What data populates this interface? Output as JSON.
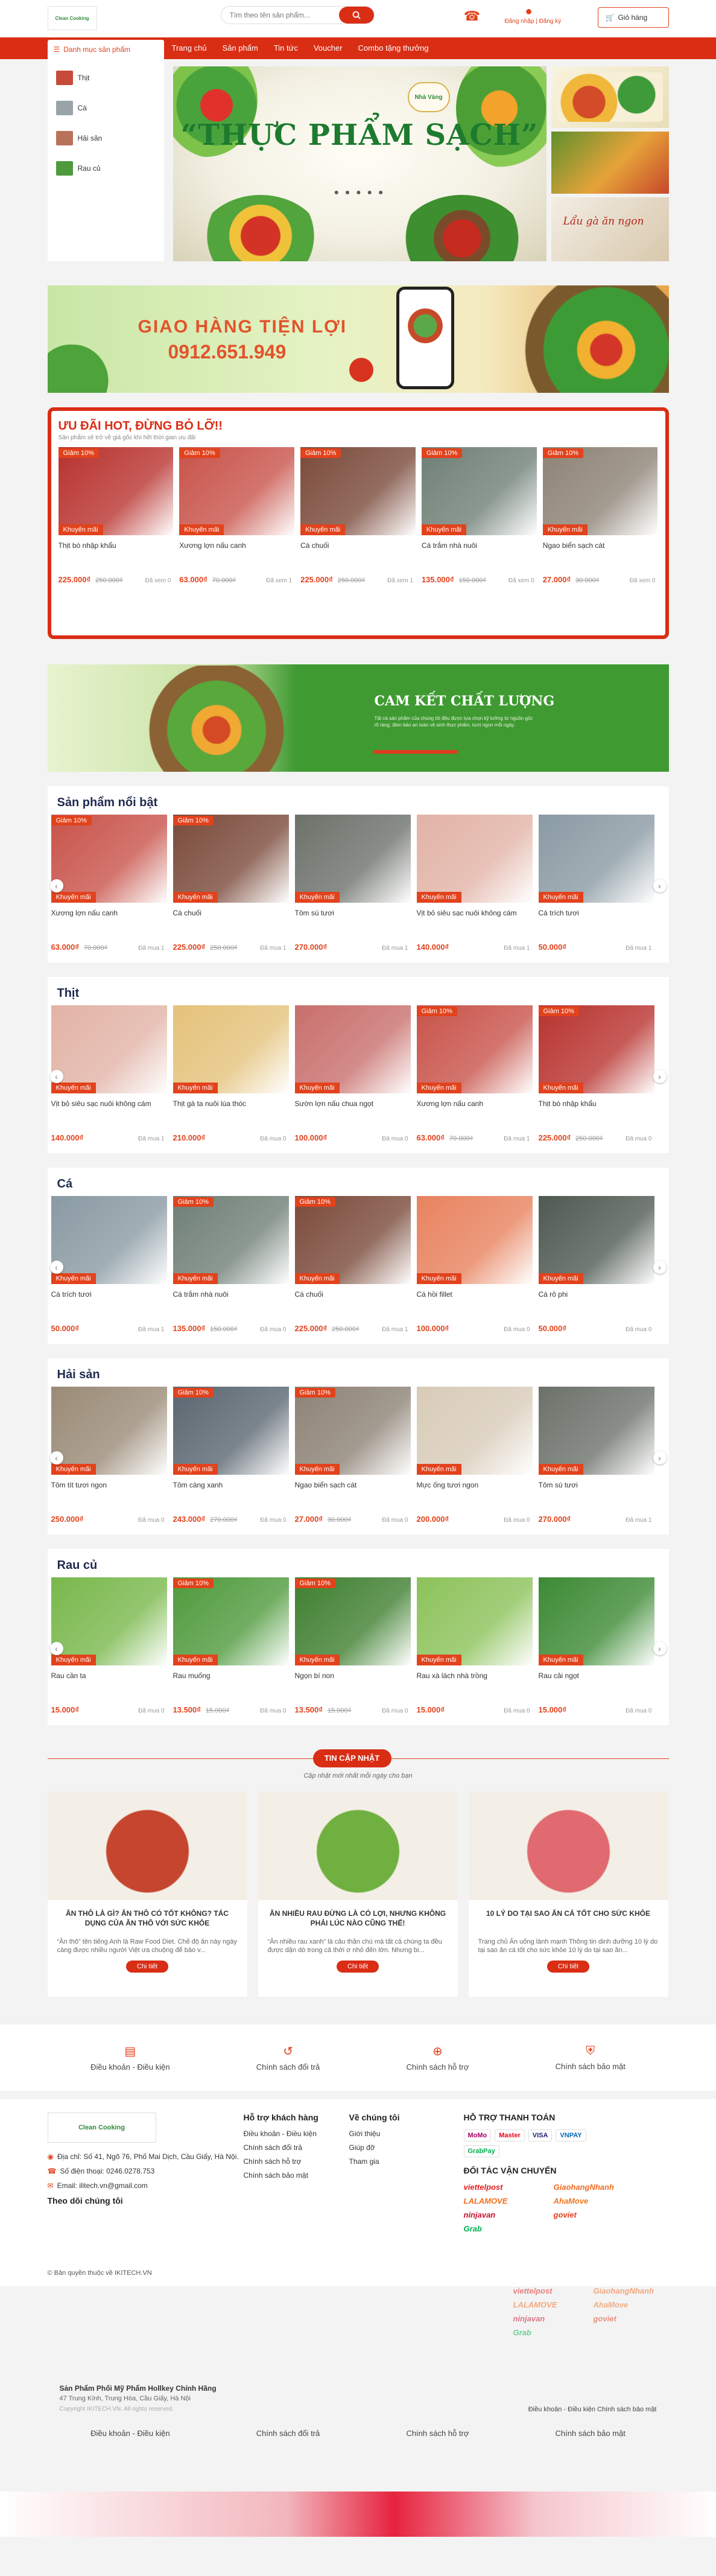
{
  "header": {
    "logo_text": "Clean Cooking",
    "search_placeholder": "Tìm theo tên sản phẩm...",
    "login_label": "Đăng nhập | Đăng ký",
    "cart_label": "Giỏ hàng",
    "cart_count": "0"
  },
  "nav": {
    "category_button": "Danh mục sản phẩm",
    "items": [
      "Trang chủ",
      "Sản phẩm",
      "Tin tức",
      "Voucher",
      "Combo tặng thưởng"
    ]
  },
  "sidebar": {
    "items": [
      "Thịt",
      "Cá",
      "Hải sản",
      "Rau củ"
    ]
  },
  "hero": {
    "title": "“THỰC PHẨM SẠCH”",
    "badge": "Nhà Vàng",
    "side_text": "Lẩu gà ăn ngon"
  },
  "delivery_banner": {
    "line1": "GIAO HÀNG TIỆN LỢI",
    "line2": "0912.651.949"
  },
  "hot_deal": {
    "title": "ƯU ĐÃI HOT, ĐỪNG BỎ LỠ!!",
    "subtitle": "Sản phẩm sẽ trở về giá gốc khi hết thời gian ưu đãi",
    "products": [
      {
        "discount": "Giảm 10%",
        "promo": "Khuyến mãi",
        "name": "Thịt bò nhập khẩu",
        "price": "225.000₫",
        "old": "250.000₫",
        "sold": "Đã xem 0",
        "color": "#b8322e"
      },
      {
        "discount": "Giảm 10%",
        "promo": "Khuyến mãi",
        "name": "Xương lợn nấu canh",
        "price": "63.000₫",
        "old": "70.000₫",
        "sold": "Đã xem 1",
        "color": "#c8534a"
      },
      {
        "discount": "Giảm 10%",
        "promo": "Khuyến mãi",
        "name": "Cá chuối",
        "price": "225.000₫",
        "old": "250.000₫",
        "sold": "Đã xem 1",
        "color": "#7a4a3a"
      },
      {
        "discount": "Giảm 10%",
        "promo": "Khuyến mãi",
        "name": "Cá trắm nhà nuôi",
        "price": "135.000₫",
        "old": "150.000₫",
        "sold": "Đã xem 0",
        "color": "#6f7f76"
      },
      {
        "discount": "Giảm 10%",
        "promo": "Khuyến mãi",
        "name": "Ngao biển sạch cát",
        "price": "27.000₫",
        "old": "30.000₫",
        "sold": "Đã xem 0",
        "color": "#8d8275"
      }
    ]
  },
  "quality_banner": {
    "title": "CAM KẾT CHẤT LƯỢNG",
    "text": "Tất cả sản phẩm của chúng tôi đều được lựa chọn kỹ lưỡng từ nguồn gốc rõ ràng, đảm bảo an toàn vệ sinh thực phẩm, tươi ngon mỗi ngày."
  },
  "sections": [
    {
      "title": "Sản phẩm nổi bật",
      "products": [
        {
          "discount": "Giảm 10%",
          "promo": "Khuyến mãi",
          "name": "Xương lợn nấu canh",
          "price": "63.000₫",
          "old": "70.000₫",
          "sold": "Đã mua 1",
          "color": "#c8534a"
        },
        {
          "discount": "Giảm 10%",
          "promo": "Khuyến mãi",
          "name": "Cá chuối",
          "price": "225.000₫",
          "old": "250.000₫",
          "sold": "Đã mua 1",
          "color": "#7a4a3a"
        },
        {
          "discount": "",
          "promo": "Khuyến mãi",
          "name": "Tôm sú tươi",
          "price": "270.000₫",
          "old": "",
          "sold": "Đã mua 1",
          "color": "#6c716a"
        },
        {
          "discount": "",
          "promo": "Khuyến mãi",
          "name": "Vịt bỏ siêu sạc nuôi không cám",
          "price": "140.000₫",
          "old": "",
          "sold": "Đã mua 1",
          "color": "#e2b3a6"
        },
        {
          "discount": "",
          "promo": "Khuyến mãi",
          "name": "Cá trích tươi",
          "price": "50.000₫",
          "old": "",
          "sold": "Đã mua 1",
          "color": "#8a9aa3"
        }
      ]
    },
    {
      "title": "Thịt",
      "products": [
        {
          "discount": "",
          "promo": "Khuyến mãi",
          "name": "Vịt bỏ siêu sạc nuôi không cám",
          "price": "140.000₫",
          "old": "",
          "sold": "Đã mua 1",
          "color": "#e2b3a6"
        },
        {
          "discount": "",
          "promo": "Khuyến mãi",
          "name": "Thịt gà ta nuôi lúa thóc",
          "price": "210.000₫",
          "old": "",
          "sold": "Đã mua 0",
          "color": "#e4c27a"
        },
        {
          "discount": "",
          "promo": "Khuyến mãi",
          "name": "Sườn lợn nấu chua ngọt",
          "price": "100.000₫",
          "old": "",
          "sold": "Đã mua 0",
          "color": "#c86f6c"
        },
        {
          "discount": "Giảm 10%",
          "promo": "Khuyến mãi",
          "name": "Xương lợn nấu canh",
          "price": "63.000₫",
          "old": "70.000₫",
          "sold": "Đã mua 1",
          "color": "#c8534a"
        },
        {
          "discount": "Giảm 10%",
          "promo": "Khuyến mãi",
          "name": "Thịt bò nhập khẩu",
          "price": "225.000₫",
          "old": "250.000₫",
          "sold": "Đã mua 0",
          "color": "#b8322e"
        }
      ]
    },
    {
      "title": "Cá",
      "products": [
        {
          "discount": "",
          "promo": "Khuyến mãi",
          "name": "Cá trích tươi",
          "price": "50.000₫",
          "old": "",
          "sold": "Đã mua 1",
          "color": "#8a9aa3"
        },
        {
          "discount": "Giảm 10%",
          "promo": "Khuyến mãi",
          "name": "Cá trắm nhà nuôi",
          "price": "135.000₫",
          "old": "150.000₫",
          "sold": "Đã mua 0",
          "color": "#6f7f76"
        },
        {
          "discount": "Giảm 10%",
          "promo": "Khuyến mãi",
          "name": "Cá chuối",
          "price": "225.000₫",
          "old": "250.000₫",
          "sold": "Đã mua 1",
          "color": "#7a4a3a"
        },
        {
          "discount": "",
          "promo": "Khuyến mãi",
          "name": "Cá hồi fillet",
          "price": "100.000₫",
          "old": "",
          "sold": "Đã mua 0",
          "color": "#e8825e"
        },
        {
          "discount": "",
          "promo": "Khuyến mãi",
          "name": "Cá rô phi",
          "price": "50.000₫",
          "old": "",
          "sold": "Đã mua 0",
          "color": "#4f5a52"
        }
      ]
    },
    {
      "title": "Hải sản",
      "products": [
        {
          "discount": "",
          "promo": "Khuyến mãi",
          "name": "Tôm tít tươi ngon",
          "price": "250.000₫",
          "old": "",
          "sold": "Đã mua 0",
          "color": "#9a8a76"
        },
        {
          "discount": "Giảm 10%",
          "promo": "Khuyến mãi",
          "name": "Tôm càng xanh",
          "price": "243.000₫",
          "old": "270.000₫",
          "sold": "Đã mua 0",
          "color": "#5a6670"
        },
        {
          "discount": "Giảm 10%",
          "promo": "Khuyến mãi",
          "name": "Ngao biển sạch cát",
          "price": "27.000₫",
          "old": "30.000₫",
          "sold": "Đã mua 0",
          "color": "#8d8275"
        },
        {
          "discount": "",
          "promo": "Khuyến mãi",
          "name": "Mực ống tươi ngon",
          "price": "200.000₫",
          "old": "",
          "sold": "Đã mua 0",
          "color": "#d8cbb8"
        },
        {
          "discount": "",
          "promo": "Khuyến mãi",
          "name": "Tôm sú tươi",
          "price": "270.000₫",
          "old": "",
          "sold": "Đã mua 1",
          "color": "#6c716a"
        }
      ]
    },
    {
      "title": "Rau củ",
      "products": [
        {
          "discount": "",
          "promo": "Khuyến mãi",
          "name": "Rau cần ta",
          "price": "15.000₫",
          "old": "",
          "sold": "Đã mua 0",
          "color": "#79b84c"
        },
        {
          "discount": "Giảm 10%",
          "promo": "Khuyến mãi",
          "name": "Rau muống",
          "price": "13.500₫",
          "old": "15.000₫",
          "sold": "Đã mua 0",
          "color": "#4f9a3c"
        },
        {
          "discount": "Giảm 10%",
          "promo": "Khuyến mãi",
          "name": "Ngọn bí non",
          "price": "13.500₫",
          "old": "15.000₫",
          "sold": "Đã mua 0",
          "color": "#3f7f30"
        },
        {
          "discount": "",
          "promo": "Khuyến mãi",
          "name": "Rau xà lách nhà trồng",
          "price": "15.000₫",
          "old": "",
          "sold": "Đã mua 0",
          "color": "#8cc25a"
        },
        {
          "discount": "",
          "promo": "Khuyến mãi",
          "name": "Rau cải ngọt",
          "price": "15.000₫",
          "old": "",
          "sold": "Đã mua 0",
          "color": "#3c8a34"
        }
      ]
    }
  ],
  "news": {
    "title": "TIN CẬP NHẬT",
    "subtitle": "Cập nhật mới nhất mỗi ngày cho bạn",
    "button": "Chi tiết",
    "items": [
      {
        "title": "ĂN THÔ LÀ GÌ? ĂN THÔ CÓ TỐT KHÔNG? TÁC DỤNG CỦA ĂN THÔ VỚI SỨC KHỎE",
        "excerpt": "“Ăn thô” tên tiếng Anh là Raw Food Diet. Chế độ ăn này ngày càng được nhiều người Việt ưa chuộng để bảo v...",
        "color": "#c6452e"
      },
      {
        "title": "ĂN NHIỀU RAU ĐỪNG LÀ CÓ LỢI, NHƯNG KHÔNG PHẢI LÚC NÀO CŨNG THẾ!",
        "excerpt": "“Ăn nhiều rau xanh” là câu thần chú mà tất cả chúng ta đều được dặn dò trong cả thời ơ nhỏ đến lớn. Nhưng bi...",
        "color": "#6fb040"
      },
      {
        "title": "10 LÝ DO TẠI SAO ĂN CÁ TỐT CHO SỨC KHỎE",
        "excerpt": "Trang chủ Ăn uống lành mạnh Thông tin dinh dưỡng 10 lý do tại sao ăn cá tốt cho sức khỏe 10 lý do tại sao ăn...",
        "color": "#e06a6f"
      }
    ]
  },
  "policies": [
    "Điều khoản - Điều kiện",
    "Chính sách đổi trả",
    "Chính sách hỗ trợ",
    "Chính sách bảo mật"
  ],
  "footer": {
    "logo_text": "Clean Cooking",
    "address": "Địa chỉ: Số 41, Ngõ 76, Phố Mai Dịch, Cầu Giấy, Hà Nội.",
    "phone": "Số điện thoại: 0246.0278.753",
    "email": "Email: ilitech.vn@gmail.com",
    "follow": "Theo dõi chúng tôi",
    "support_title": "Hỗ trợ khách hàng",
    "support_links": [
      "Điều khoản - Điều kiện",
      "Chính sách đổi trả",
      "Chính sách hỗ trợ",
      "Chính sách bảo mật"
    ],
    "about_title": "Về chúng tôi",
    "about_links": [
      "Giới thiệu",
      "Giúp đỡ",
      "Tham gia"
    ],
    "pay_title": "HỖ TRỢ THANH TOÁN",
    "pay_methods": [
      "MoMo",
      "Master",
      "VISA",
      "VNPAY",
      "GrabPay"
    ],
    "ship_title": "ĐỐI TÁC VẬN CHUYỂN",
    "ship_partners": [
      "viettelpost",
      "GiaohangNhanh",
      "LALAMOVE",
      "AhaMove",
      "ninjavan",
      "goviet",
      "Grab"
    ],
    "copyright": "© Bản quyền thuộc về IKITECH.VN"
  },
  "ghost": {
    "info_title": "Sản Phẩm Phối Mỹ Phẩm Hollkey Chính Hãng",
    "info_sub": "47 Trung Kính, Trung Hòa, Cầu Giấy, Hà Nội",
    "info_copy": "Copyright IKITECH.VN. All rights reserved.",
    "footer_links": "Điều khoản - Điều kiện  Chính sách bảo mật"
  },
  "colors": {
    "brand": "#d92d14",
    "accent": "#e2421c",
    "heading": "#1f2a4f"
  }
}
